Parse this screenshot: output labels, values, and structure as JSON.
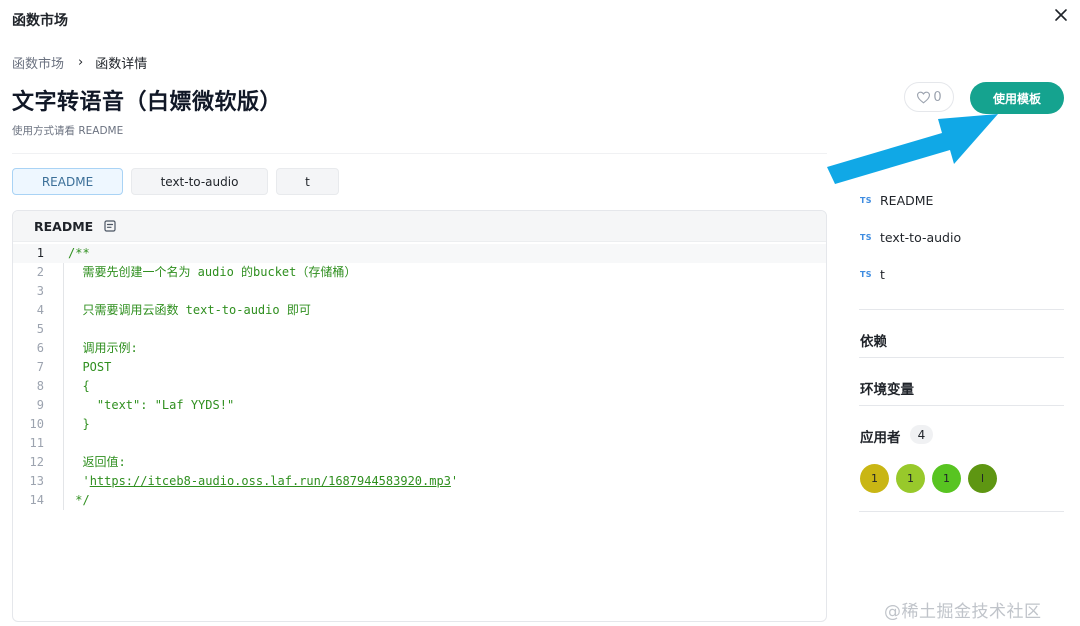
{
  "modal": {
    "title": "函数市场"
  },
  "breadcrumb": {
    "parent": "函数市场",
    "separator": "›",
    "current": "函数详情"
  },
  "page": {
    "title": "文字转语音（白嫖微软版）",
    "subtitle": "使用方式请看 README"
  },
  "actions": {
    "like_count": "0",
    "use_template_label": "使用模板"
  },
  "tabs": [
    {
      "label": "README",
      "active": true
    },
    {
      "label": "text-to-audio",
      "active": false
    },
    {
      "label": "t",
      "active": false
    }
  ],
  "editor": {
    "header_label": "README",
    "lines": [
      {
        "n": "1",
        "text": "/**"
      },
      {
        "n": "2",
        "text": "  需要先创建一个名为 audio 的bucket（存储桶）"
      },
      {
        "n": "3",
        "text": ""
      },
      {
        "n": "4",
        "text": "  只需要调用云函数 text-to-audio 即可"
      },
      {
        "n": "5",
        "text": ""
      },
      {
        "n": "6",
        "text": "  调用示例:"
      },
      {
        "n": "7",
        "text": "  POST"
      },
      {
        "n": "8",
        "text": "  {"
      },
      {
        "n": "9",
        "text": "    \"text\": \"Laf YYDS!\""
      },
      {
        "n": "10",
        "text": "  }"
      },
      {
        "n": "11",
        "text": ""
      },
      {
        "n": "12",
        "text": "  返回值:"
      },
      {
        "n": "13",
        "text": "  'https://itceb8-audio.oss.laf.run/1687944583920.mp3'",
        "url": "https://itceb8-audio.oss.laf.run/1687944583920.mp3"
      },
      {
        "n": "14",
        "text": " */"
      }
    ]
  },
  "sidebar": {
    "files": [
      {
        "badge": "TS",
        "name": "README"
      },
      {
        "badge": "TS",
        "name": "text-to-audio"
      },
      {
        "badge": "TS",
        "name": "t"
      }
    ],
    "dependencies_heading": "依赖",
    "env_heading": "环境变量",
    "users_heading": "应用者",
    "users_count": "4",
    "avatars": [
      {
        "label": "1",
        "color": "#c9b614"
      },
      {
        "label": "1",
        "color": "#98c92b"
      },
      {
        "label": "1",
        "color": "#58c421"
      },
      {
        "label": "l",
        "color": "#5e9612"
      }
    ]
  },
  "colors": {
    "accent": "#15a38f",
    "arrow": "#10a8e6",
    "code_green": "#2f8f1f",
    "ts_blue": "#3d8be0"
  },
  "watermark": "@稀土掘金技术社区"
}
